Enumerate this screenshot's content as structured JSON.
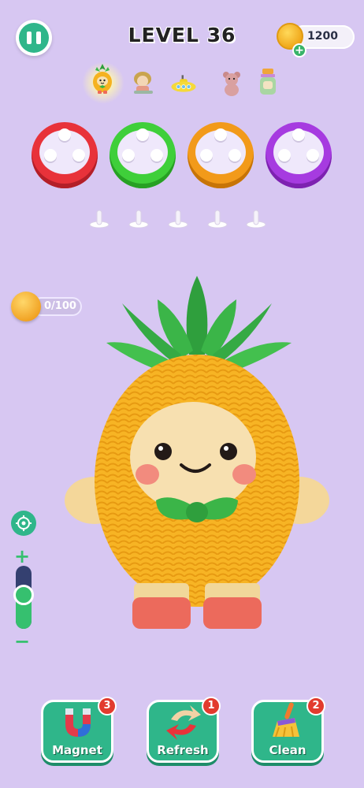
{
  "header": {
    "level_title": "LEVEL 36",
    "coins": "1200"
  },
  "level_icons": [
    {
      "name": "pineapple-icon",
      "active": true
    },
    {
      "name": "girl-icon",
      "active": false
    },
    {
      "name": "submarine-icon",
      "active": false
    },
    {
      "name": "teddy-bear-icon",
      "active": false
    },
    {
      "name": "jar-icon",
      "active": false
    }
  ],
  "rings": [
    {
      "color": "#e8323a"
    },
    {
      "color": "#3fcf3a"
    },
    {
      "color": "#f29a1a"
    },
    {
      "color": "#a63be0"
    }
  ],
  "yarn_counter": "0/100",
  "zoom_level": 0.6,
  "tools": [
    {
      "label": "Magnet",
      "count": "3"
    },
    {
      "label": "Refresh",
      "count": "1"
    },
    {
      "label": "Clean",
      "count": "2"
    }
  ]
}
